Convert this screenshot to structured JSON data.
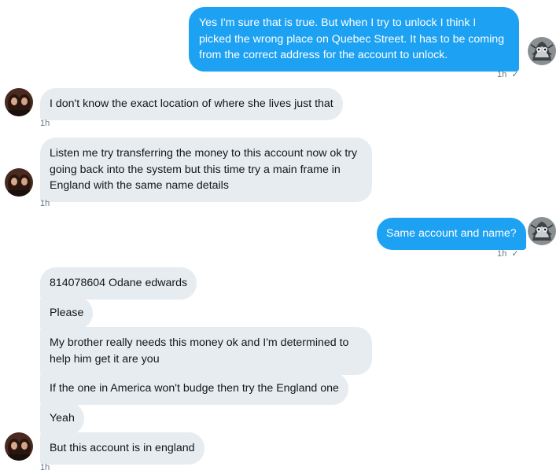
{
  "colors": {
    "sent_bubble": "#1da1f2",
    "received_bubble": "#e6ecf0",
    "timestamp": "#657786"
  },
  "messages": [
    {
      "side": "sent",
      "text": "Yes I'm sure that is true. But when I try to unlock I think I picked the wrong place on Quebec Street. It has to be coming from the correct address for the account to unlock.",
      "time": "1h",
      "read_icon": "checkmark-icon"
    },
    {
      "side": "received",
      "text": "I don't know the exact location of where she lives just that",
      "time": "1h"
    },
    {
      "side": "received",
      "text": "Listen me try transferring the money to this account now ok try going back into the system but this time try a main frame in England with the same name details",
      "time": "1h"
    },
    {
      "side": "sent",
      "text": "Same account and name?",
      "time": "1h",
      "read_icon": "checkmark-icon"
    },
    {
      "side": "received",
      "text": "814078604 Odane edwards"
    },
    {
      "side": "received",
      "text": "Please"
    },
    {
      "side": "received",
      "text": "My brother really needs this money ok and I'm determined to help him get it are you"
    },
    {
      "side": "received",
      "text": "If the one in America won't budge then try the England one"
    },
    {
      "side": "received",
      "text": "Yeah"
    },
    {
      "side": "received",
      "text": "But this account is in england",
      "time": "1h"
    }
  ],
  "icons": {
    "read_receipt": "✓",
    "my_avatar": "owl-avatar-icon",
    "their_avatar": "two-women-avatar-icon"
  }
}
